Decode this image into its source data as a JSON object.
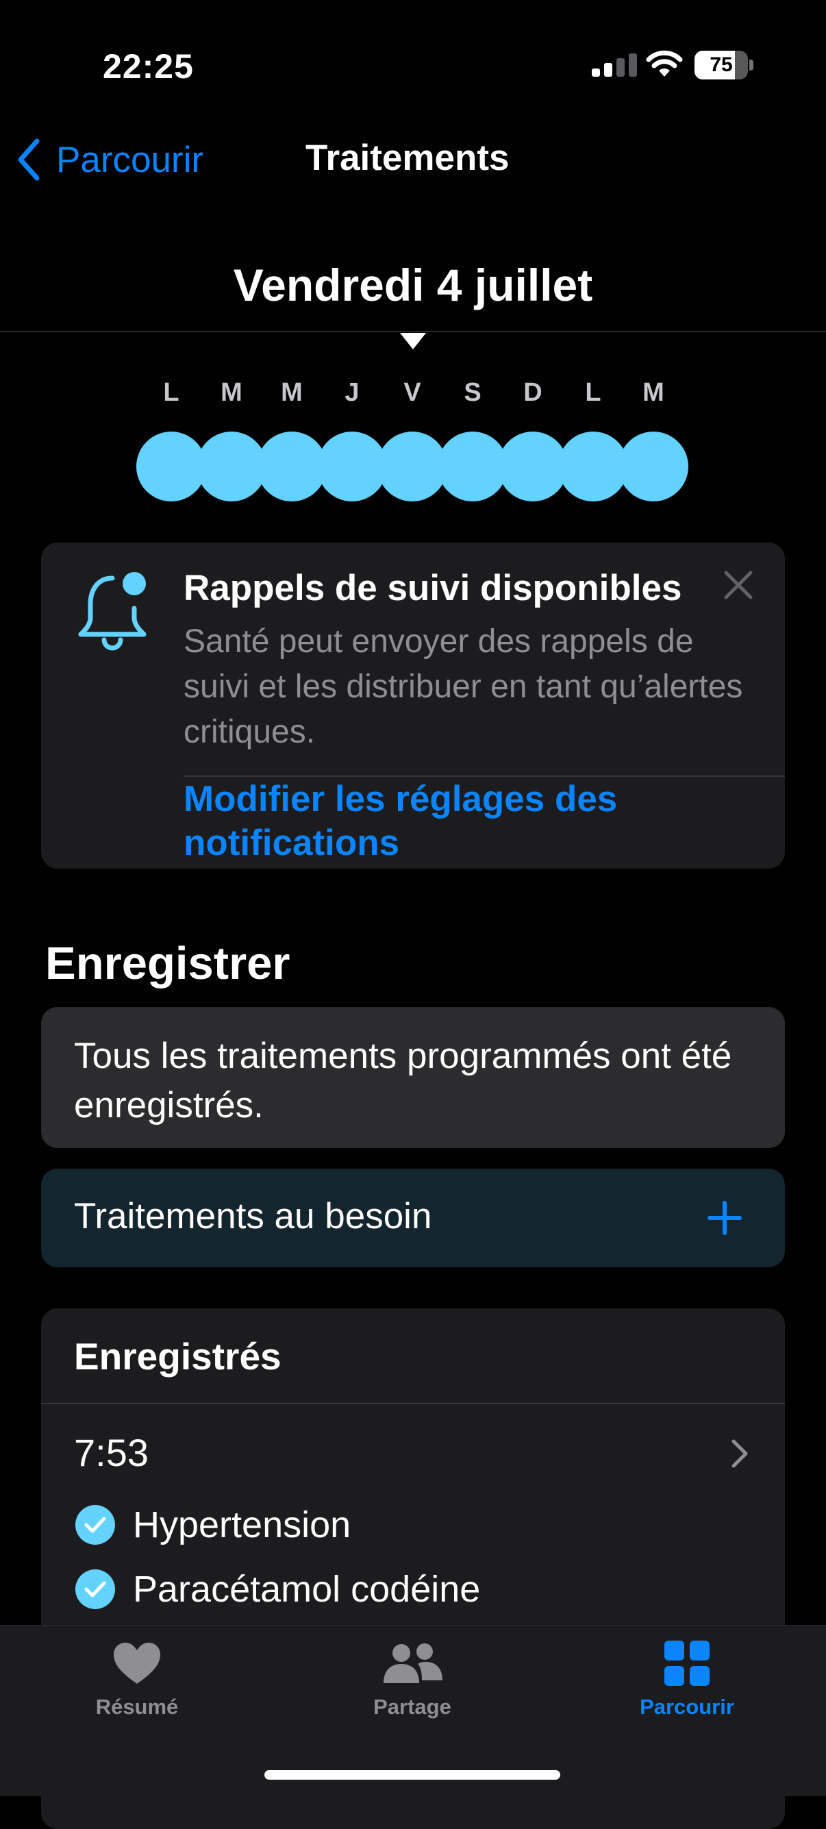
{
  "status_bar": {
    "time": "22:25",
    "battery_percent": "75",
    "battery_level": 0.75
  },
  "nav": {
    "back_label": "Parcourir",
    "title": "Traitements"
  },
  "date": {
    "title": "Vendredi 4 juillet"
  },
  "week": {
    "days": [
      "L",
      "M",
      "M",
      "J",
      "V",
      "S",
      "D",
      "L",
      "M"
    ],
    "selected_index": 4,
    "dot_color": "#64d2ff"
  },
  "notification": {
    "title": "Rappels de suivi disponibles",
    "body": "Santé peut envoyer des rappels de suivi et les distribuer en tant qu’alertes critiques.",
    "link": "Modifier les réglages des notifications"
  },
  "log": {
    "section_title": "Enregistrer",
    "status_message": "Tous les traitements programmés ont été enregistrés.",
    "as_needed_label": "Traitements au besoin"
  },
  "logged": {
    "header": "Enregistrés",
    "entries": [
      {
        "time": "7:53",
        "medications": [
          "Hypertension",
          "Paracétamol codéine"
        ]
      }
    ]
  },
  "tab_bar": {
    "tabs": [
      {
        "label": "Résumé",
        "icon": "heart-icon",
        "active": false
      },
      {
        "label": "Partage",
        "icon": "people-icon",
        "active": false
      },
      {
        "label": "Parcourir",
        "icon": "grid-icon",
        "active": true
      }
    ],
    "active_color": "#0a84ff",
    "inactive_color": "#8e8e93"
  },
  "colors": {
    "accent": "#0a84ff",
    "teal": "#64d2ff"
  }
}
